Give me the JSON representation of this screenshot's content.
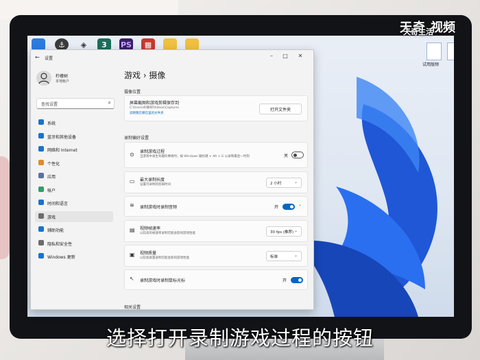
{
  "watermark": {
    "line1": "天奇",
    "line2": "天奇生活",
    "line3": "视频"
  },
  "taskbar": {
    "icons": [
      "app-icon-blue",
      "git-icon",
      "unity-icon",
      "three-icon",
      "ps-icon",
      "office-icon",
      "folder-icon",
      "folder-icon"
    ],
    "ps_label": "PS",
    "three_label": "3"
  },
  "desktop": {
    "icon_label": "试用版频"
  },
  "window": {
    "title": "设置",
    "controls": {
      "minimize": "–",
      "maximize": "□",
      "close": "✕"
    },
    "user": {
      "name": "柠檬树",
      "account": "本地帐户"
    },
    "search_placeholder": "查找设置",
    "nav": [
      {
        "label": "系统",
        "color": "#1a73c9"
      },
      {
        "label": "蓝牙和其他设备",
        "color": "#1a73c9"
      },
      {
        "label": "网络和 Internet",
        "color": "#1a73c9"
      },
      {
        "label": "个性化",
        "color": "#e08a2c"
      },
      {
        "label": "应用",
        "color": "#5a6fa6"
      },
      {
        "label": "帐户",
        "color": "#2f9e6b"
      },
      {
        "label": "时间和语言",
        "color": "#1a73c9"
      },
      {
        "label": "游戏",
        "color": "#6b6b6b"
      },
      {
        "label": "辅助功能",
        "color": "#1a73c9"
      },
      {
        "label": "隐私和安全性",
        "color": "#6b6b6b"
      },
      {
        "label": "Windows 更新",
        "color": "#1a73c9"
      }
    ],
    "breadcrumb": "游戏  ›  摄像",
    "section_capture_location": "摄像位置",
    "capture_folder": {
      "title": "屏幕截图和游戏剪辑保存到",
      "path": "C:\\Users\\柠檬树\\Videos\\Captures",
      "link": "说明我在哪在里的文件夹",
      "button": "打开文件夹"
    },
    "section_recording": "录制偏好设置",
    "rows": [
      {
        "title": "录制游戏过程",
        "sub": "当游戏中发生有趣的事情时，按 Windows 徽标键 + Alt + G 以录制最后一时刻",
        "control": "toggle",
        "state": "关",
        "on": false
      },
      {
        "title": "最大录制长度",
        "sub": "设置可录制的剪辑时间",
        "control": "dropdown",
        "value": "2 小时"
      },
      {
        "title": "录制游戏时录制音频",
        "sub": "",
        "control": "toggle",
        "state": "开",
        "on": true
      },
      {
        "title": "视频帧速率",
        "sub": "以较高的帧速率录制可能会影响游戏性能",
        "control": "dropdown",
        "value": "30 fps (推荐)"
      },
      {
        "title": "视频质量",
        "sub": "以较高质量录制可能会影响游戏性能",
        "control": "dropdown",
        "value": "标准"
      },
      {
        "title": "录制游戏时录制鼠标光标",
        "sub": "",
        "control": "toggle",
        "state": "开",
        "on": true
      }
    ],
    "section_related": "相关设置"
  },
  "subtitle": "选择打开录制游戏过程的按钮"
}
